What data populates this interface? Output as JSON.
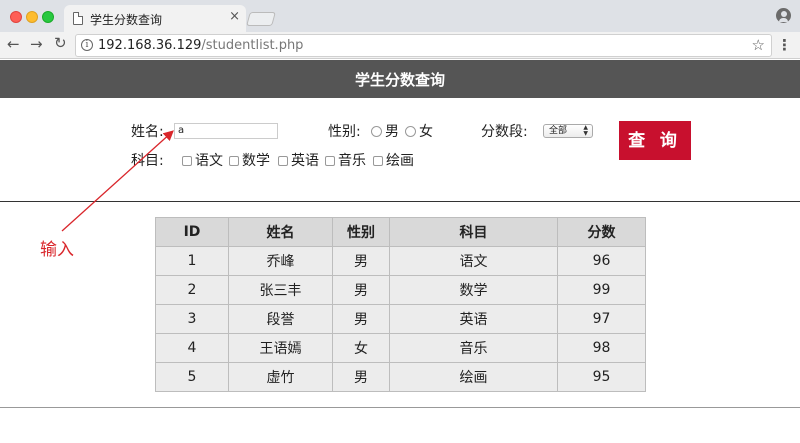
{
  "browser": {
    "tab_title": "学生分数查询",
    "tab_close": "×",
    "url_host": "192.168.36.129",
    "url_path": "/studentlist.php",
    "info_glyph": "i"
  },
  "page": {
    "header_title": "学生分数查询"
  },
  "form": {
    "name_label": "姓名:",
    "name_value": "a",
    "gender_label": "性别:",
    "gender_options": [
      "男",
      "女"
    ],
    "score_range_label": "分数段:",
    "score_range_selected": "全部",
    "subject_label": "科目:",
    "subjects": [
      "语文",
      "数学",
      "英语",
      "音乐",
      "绘画"
    ],
    "query_button": "查 询"
  },
  "table": {
    "headers": [
      "ID",
      "姓名",
      "性别",
      "科目",
      "分数"
    ],
    "rows": [
      [
        "1",
        "乔峰",
        "男",
        "语文",
        "96"
      ],
      [
        "2",
        "张三丰",
        "男",
        "数学",
        "99"
      ],
      [
        "3",
        "段誉",
        "男",
        "英语",
        "97"
      ],
      [
        "4",
        "王语嫣",
        "女",
        "音乐",
        "98"
      ],
      [
        "5",
        "虚竹",
        "男",
        "绘画",
        "95"
      ]
    ]
  },
  "annotation": {
    "text": "输入",
    "color": "#d9262b"
  },
  "colors": {
    "header_bg": "#555555",
    "button_bg": "#c8102e"
  }
}
